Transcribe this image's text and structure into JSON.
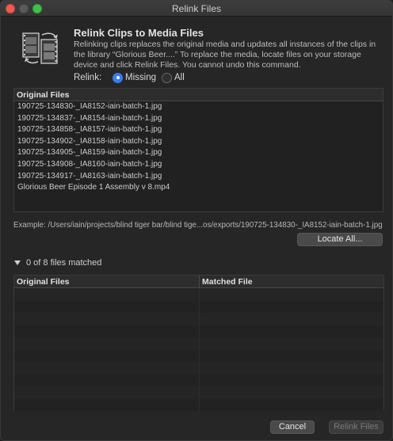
{
  "window": {
    "title": "Relink Files"
  },
  "header": {
    "title": "Relink Clips to Media Files",
    "description": "Relinking clips replaces the original media and updates all instances of the clips in the library “Glorious Beer....” To replace the media, locate files on your storage device and click Relink Files. You cannot undo this command.",
    "icon": "relink-film-icon"
  },
  "relink": {
    "label": "Relink:",
    "options": [
      {
        "label": "Missing",
        "selected": true
      },
      {
        "label": "All",
        "selected": false
      }
    ]
  },
  "original_files": {
    "header": "Original Files",
    "rows": [
      "190725-134830-_IA8152-iain-batch-1.jpg",
      "190725-134837-_IA8154-iain-batch-1.jpg",
      "190725-134858-_IA8157-iain-batch-1.jpg",
      "190725-134902-_IA8158-iain-batch-1.jpg",
      "190725-134905-_IA8159-iain-batch-1.jpg",
      "190725-134908-_IA8160-iain-batch-1.jpg",
      "190725-134917-_IA8163-iain-batch-1.jpg",
      "Glorious Beer Episode 1 Assembly v 8.mp4"
    ]
  },
  "example_path": "Example: /Users/iain/projects/blind tiger bar/blind tige...os/exports/190725-134830-_IA8152-iain-batch-1.jpg",
  "locate_all_label": "Locate All...",
  "matched": {
    "summary": "0 of 8 files matched",
    "col_original": "Original Files",
    "col_matched": "Matched File"
  },
  "footer": {
    "cancel_label": "Cancel",
    "relink_label": "Relink Files"
  },
  "colors": {
    "accent": "#3a7bf6",
    "close": "#ee5b53",
    "maximize": "#3fc04c"
  }
}
